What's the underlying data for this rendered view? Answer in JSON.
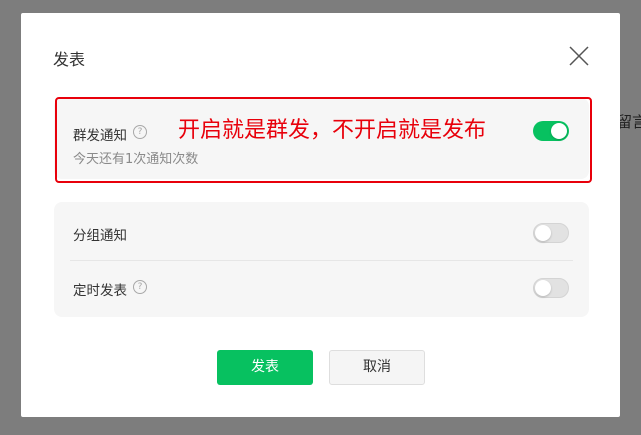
{
  "background": {
    "peek_text": "留言"
  },
  "dialog": {
    "title": "发表",
    "close_icon": "close-icon",
    "mass_notify": {
      "label": "群发通知",
      "help_icon": "question-circle-icon",
      "help_glyph": "?",
      "subtext": "今天还有1次通知次数",
      "enabled": true
    },
    "annotation": "开启就是群发，不开启就是发布",
    "options": [
      {
        "label": "分组通知",
        "has_help": false,
        "enabled": false
      },
      {
        "label": "定时发表",
        "has_help": true,
        "help_glyph": "?",
        "enabled": false
      }
    ],
    "buttons": {
      "publish": "发表",
      "cancel": "取消"
    }
  },
  "colors": {
    "accent": "#07c160",
    "annotation": "#e8000b",
    "overlay": "#7d7d7d"
  }
}
